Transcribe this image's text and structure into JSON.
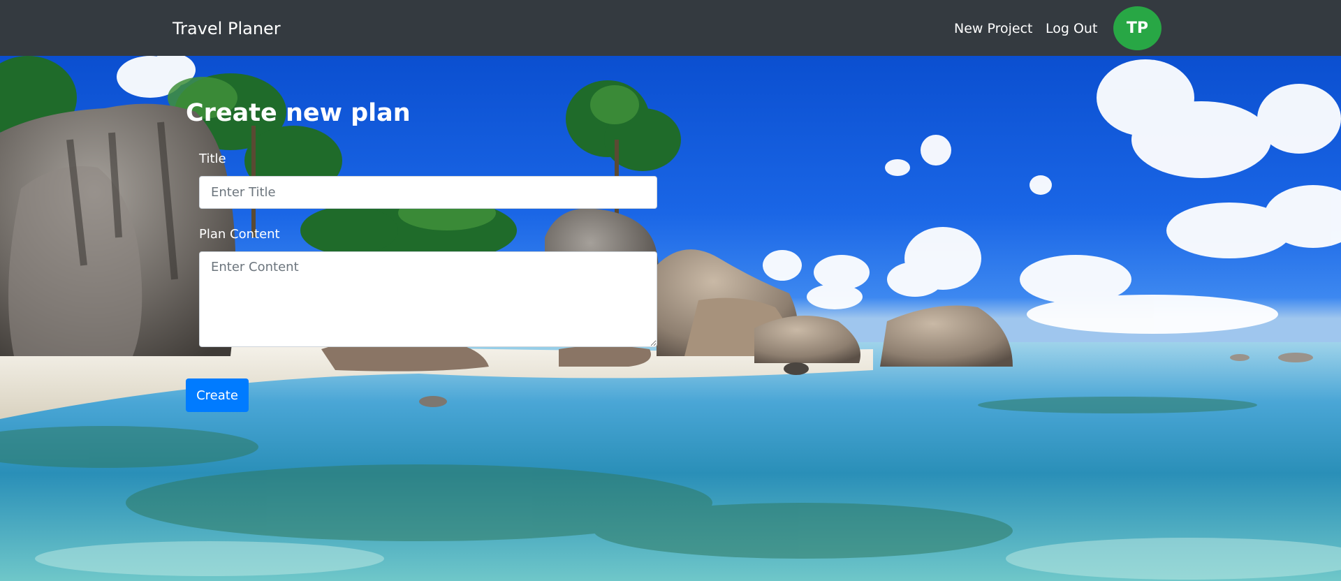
{
  "navbar": {
    "brand": "Travel Planer",
    "links": {
      "new_project": "New Project",
      "log_out": "Log Out"
    },
    "avatar_initials": "TP",
    "colors": {
      "background": "#343a40",
      "avatar": "#28a745"
    }
  },
  "form": {
    "heading": "Create new plan",
    "title_field": {
      "label": "Title",
      "placeholder": "Enter Title",
      "value": ""
    },
    "content_field": {
      "label": "Plan Content",
      "placeholder": "Enter Content",
      "value": ""
    },
    "submit_label": "Create",
    "colors": {
      "submit": "#007bff"
    }
  },
  "background": {
    "scene": "tropical beach with granite boulders, palm trees, blue sky with clouds and clear turquoise water"
  }
}
